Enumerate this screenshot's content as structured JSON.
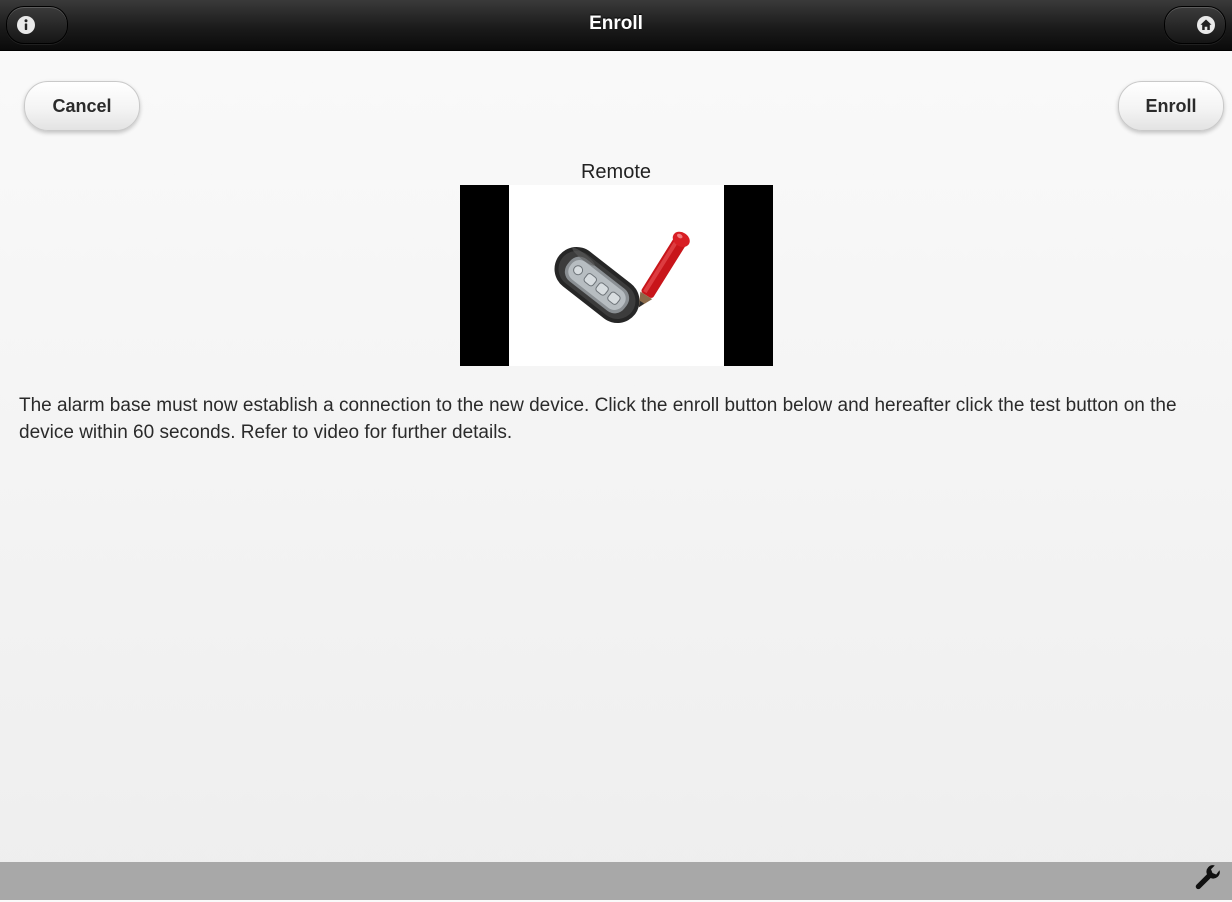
{
  "header": {
    "title": "Enroll",
    "left_icon": "info-icon",
    "right_icon": "home-icon"
  },
  "actions": {
    "cancel_label": "Cancel",
    "enroll_label": "Enroll"
  },
  "device": {
    "label": "Remote",
    "image_icon": "remote-keyfob-pencil-icon"
  },
  "instructions": "The alarm base must now establish a connection to the new device. Click the enroll button below and hereafter click the test button on the device within 60 seconds. Refer to video for further details.",
  "footer": {
    "icon": "wrench-icon"
  },
  "colors": {
    "header_bg": "#1b1b1b",
    "page_bg": "#f2f2f2",
    "footer_bg": "#a8a8a8",
    "pencil_red": "#c8151a"
  }
}
